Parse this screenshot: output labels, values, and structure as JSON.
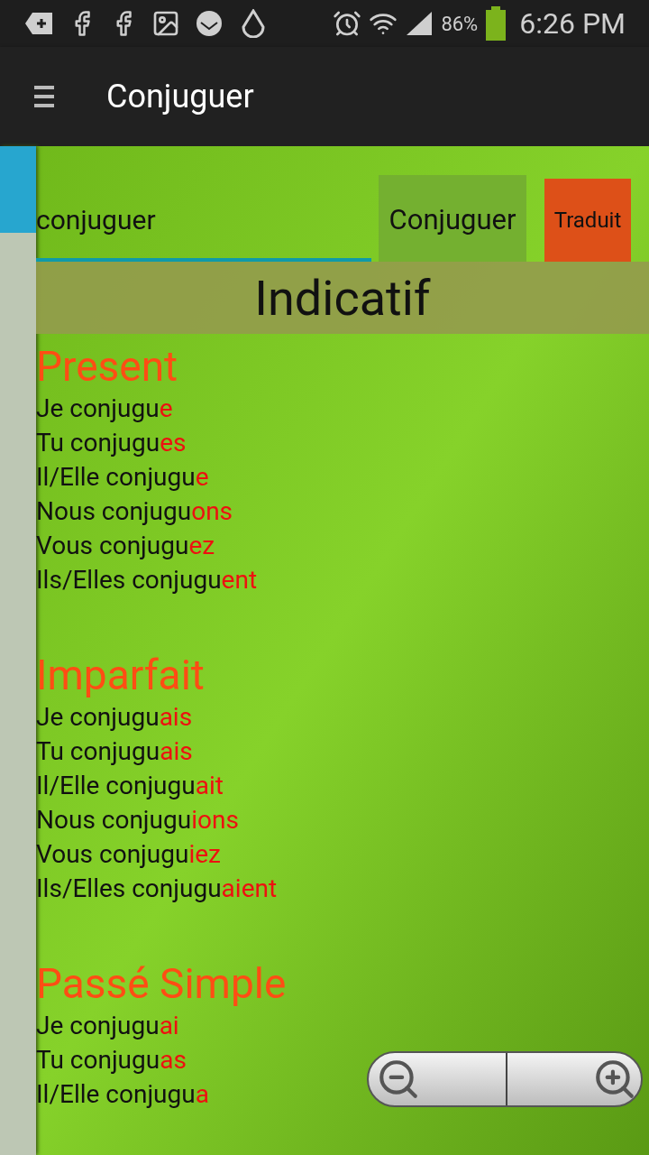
{
  "status_bar": {
    "battery": "86%",
    "time": "6:26 PM"
  },
  "app_bar": {
    "title": "Conjuguer"
  },
  "search": {
    "value": "conjuguer",
    "button": "Conjuguer",
    "translate_button": "Traduit"
  },
  "mood": "Indicatif",
  "tenses": [
    {
      "name": "Present",
      "forms": [
        {
          "stem": "Je conjugu",
          "ending": "e"
        },
        {
          "stem": "Tu conjugu",
          "ending": "es"
        },
        {
          "stem": "Il/Elle conjugu",
          "ending": "e"
        },
        {
          "stem": "Nous conjugu",
          "ending": "ons"
        },
        {
          "stem": "Vous conjugu",
          "ending": "ez"
        },
        {
          "stem": "Ils/Elles conjugu",
          "ending": "ent"
        }
      ]
    },
    {
      "name": "Imparfait",
      "forms": [
        {
          "stem": "Je conjugu",
          "ending": "ais"
        },
        {
          "stem": "Tu conjugu",
          "ending": "ais"
        },
        {
          "stem": "Il/Elle conjugu",
          "ending": "ait"
        },
        {
          "stem": "Nous conjugu",
          "ending": "ions"
        },
        {
          "stem": "Vous conjugu",
          "ending": "iez"
        },
        {
          "stem": "Ils/Elles conjugu",
          "ending": "aient"
        }
      ]
    },
    {
      "name": "Passé Simple",
      "forms": [
        {
          "stem": "Je conjugu",
          "ending": "ai"
        },
        {
          "stem": "Tu conjugu",
          "ending": "as"
        },
        {
          "stem": "Il/Elle conjugu",
          "ending": "a"
        }
      ]
    }
  ]
}
